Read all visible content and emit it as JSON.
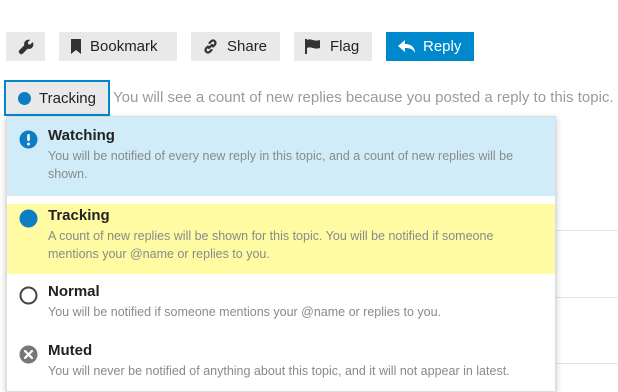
{
  "toolbar": {
    "wrench_label": "",
    "bookmark_label": "Bookmark",
    "share_label": "Share",
    "flag_label": "Flag",
    "reply_label": "Reply"
  },
  "notification": {
    "current_level": "Tracking",
    "description": "You will see a count of new replies because you posted a reply to this topic."
  },
  "options": [
    {
      "title": "Watching",
      "description": "You will be notified of every new reply in this topic, and a count of new replies will be shown.",
      "icon": "exclamation-circle-icon",
      "highlight": "#d1ecf9"
    },
    {
      "title": "Tracking",
      "description": "A count of new replies will be shown for this topic. You will be notified if someone mentions your @name or replies to you.",
      "icon": "filled-circle-icon",
      "highlight": "#fefba2"
    },
    {
      "title": "Normal",
      "description": "You will be notified if someone mentions your @name or replies to you.",
      "icon": "empty-circle-icon"
    },
    {
      "title": "Muted",
      "description": "You will never be notified of anything about this topic, and it will not appear in latest.",
      "icon": "times-circle-icon"
    }
  ],
  "colors": {
    "accent": "#0088cc",
    "button_bg": "#e9e9e9",
    "muted_text": "#9a9a9a"
  }
}
